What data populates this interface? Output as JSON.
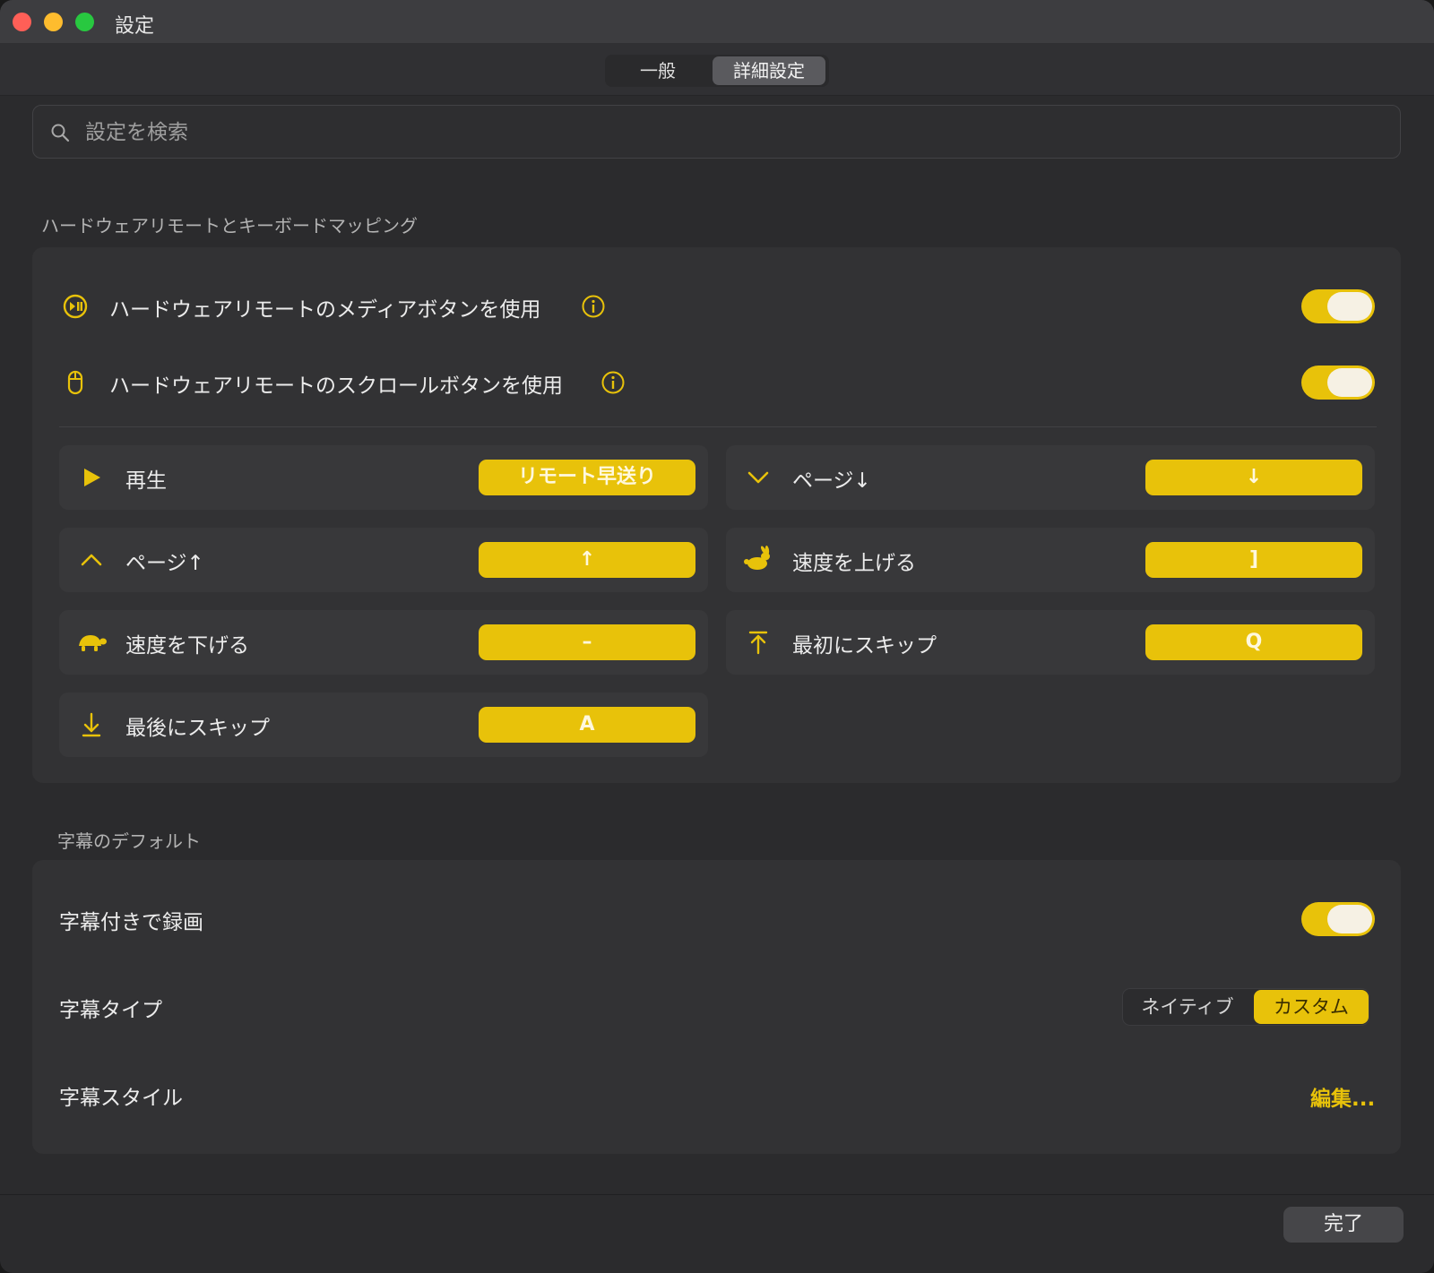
{
  "window": {
    "title": "設定"
  },
  "tabs": [
    {
      "label": "一般"
    },
    {
      "label": "詳細設定",
      "selected": true
    }
  ],
  "search": {
    "placeholder": "設定を検索",
    "value": ""
  },
  "hardware_section": {
    "title": "ハードウェアリモートとキーボードマッピング",
    "toggles": [
      {
        "label": "ハードウェアリモートのメディアボタンを使用",
        "icon": "play-pause-circle-icon",
        "on": true
      },
      {
        "label": "ハードウェアリモートのスクロールボタンを使用",
        "icon": "mouse-icon",
        "on": true
      }
    ],
    "mappings": [
      {
        "label": "再生",
        "key": "リモート早送り",
        "icon": "play-icon"
      },
      {
        "label": "ページ↓",
        "key": "↓",
        "icon": "chevron-down-icon"
      },
      {
        "label": "ページ↑",
        "key": "↑",
        "icon": "chevron-up-icon"
      },
      {
        "label": "速度を上げる",
        "key": "]",
        "icon": "rabbit-icon"
      },
      {
        "label": "速度を下げる",
        "key": "–",
        "icon": "turtle-icon"
      },
      {
        "label": "最初にスキップ",
        "key": "Q",
        "icon": "skip-to-first-icon"
      },
      {
        "label": "最後にスキップ",
        "key": "A",
        "icon": "skip-to-last-icon"
      }
    ]
  },
  "subtitle_section": {
    "title": "字幕のデフォルト",
    "record_with_subtitles": {
      "label": "字幕付きで録画",
      "on": true
    },
    "subtitle_type": {
      "label": "字幕タイプ",
      "options": [
        "ネイティブ",
        "カスタム"
      ],
      "selected": "カスタム"
    },
    "subtitle_style": {
      "label": "字幕スタイル",
      "action": "編集..."
    }
  },
  "footer": {
    "done_label": "完了"
  },
  "colors": {
    "accent": "#e8c20a",
    "background": "#2b2b2d",
    "card": "#323234"
  }
}
